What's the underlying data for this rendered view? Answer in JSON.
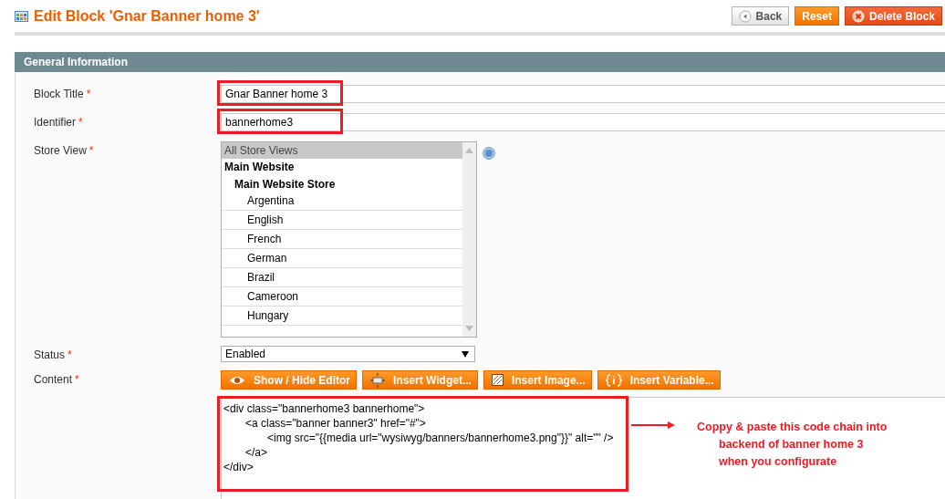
{
  "header": {
    "title": "Edit Block 'Gnar Banner home 3'",
    "buttons": [
      {
        "label": "Back",
        "kind": "back"
      },
      {
        "label": "Reset",
        "kind": "reset"
      },
      {
        "label": "Delete Block",
        "kind": "delete"
      }
    ]
  },
  "section": {
    "title": "General Information"
  },
  "fields": [
    {
      "kind": "text",
      "label": "Block Title",
      "required": "*",
      "value": "Gnar Banner home 3",
      "highlighted": true
    },
    {
      "kind": "text",
      "label": "Identifier",
      "required": "*",
      "value": "bannerhome3",
      "highlighted": true
    },
    {
      "kind": "multiselect",
      "label": "Store View",
      "required": "*",
      "help": true,
      "options": [
        {
          "label": "All Store Views",
          "selected": true
        },
        {
          "label": "Main Website",
          "selected": false,
          "children": [
            {
              "label": "Main Website Store",
              "selected": false,
              "children": [
                {
                  "label": "Argentina",
                  "selected": false
                },
                {
                  "label": "English",
                  "selected": false
                },
                {
                  "label": "French",
                  "selected": false
                },
                {
                  "label": "German",
                  "selected": false
                },
                {
                  "label": "Brazil",
                  "selected": false
                },
                {
                  "label": "Cameroon",
                  "selected": false
                },
                {
                  "label": "Hungary",
                  "selected": false
                }
              ]
            }
          ]
        }
      ]
    },
    {
      "kind": "select",
      "label": "Status",
      "required": "*",
      "value": "Enabled"
    },
    {
      "kind": "editor",
      "label": "Content",
      "required": "*",
      "highlighted": true,
      "buttons": [
        {
          "label": "Show / Hide Editor",
          "kind": "eye"
        },
        {
          "label": "Insert Widget...",
          "kind": "widget"
        },
        {
          "label": "Insert Image...",
          "kind": "image"
        },
        {
          "label": "Insert Variable...",
          "kind": "variable"
        }
      ],
      "lines": [
        {
          "text": "<div class=\"bannerhome3 bannerhome\">",
          "children": [
            {
              "text": "<a class=\"banner banner3\" href=\"#\">",
              "children": [
                {
                  "text": "<img src=\"{{media url=\"wysiwyg/banners/bannerhome3.png\"}}\" alt=\"\" />"
                }
              ]
            },
            {
              "text": "</a>"
            }
          ]
        },
        {
          "text": "</div>"
        }
      ]
    }
  ],
  "annotation": {
    "lines": [
      "Coppy & paste this code chain into",
      "backend of banner home 3",
      "when you configurate"
    ]
  }
}
